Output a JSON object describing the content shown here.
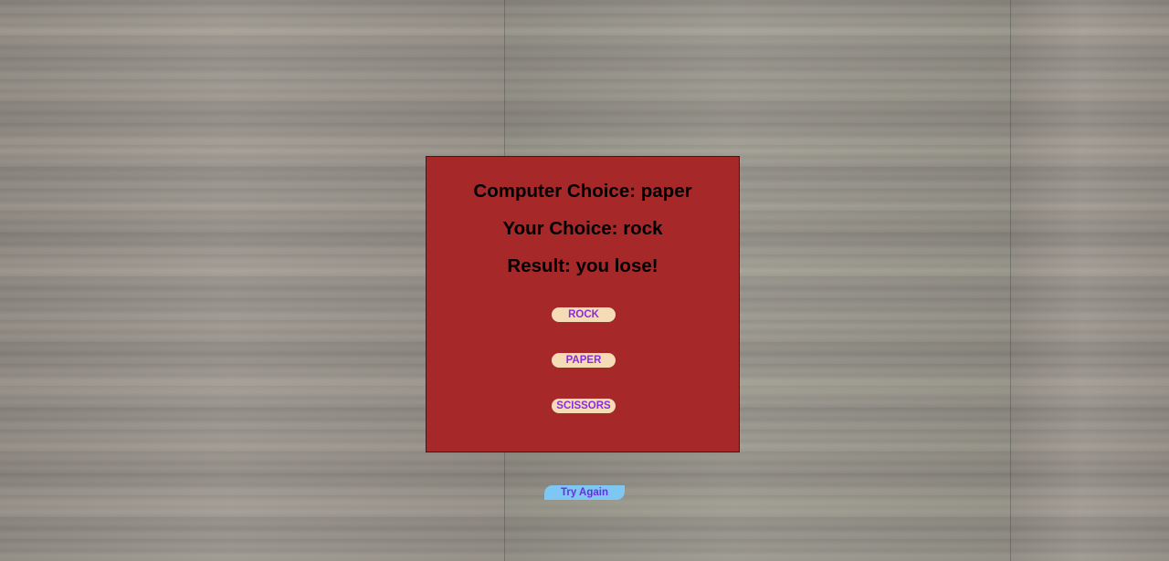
{
  "results": {
    "computer_choice": "Computer Choice: paper",
    "your_choice": "Your Choice: rock",
    "result": "Result: you lose!"
  },
  "buttons": {
    "rock": "ROCK",
    "paper": "PAPER",
    "scissors": "SCISSORS",
    "try_again": "Try Again"
  },
  "colors": {
    "panel": "#a62828",
    "choice_button_bg": "#f6dcb6",
    "choice_button_text": "#8a2be2",
    "try_again_bg": "#7fc7f3",
    "try_again_text": "#6a2ee0"
  },
  "background": "wood-floor-texture"
}
